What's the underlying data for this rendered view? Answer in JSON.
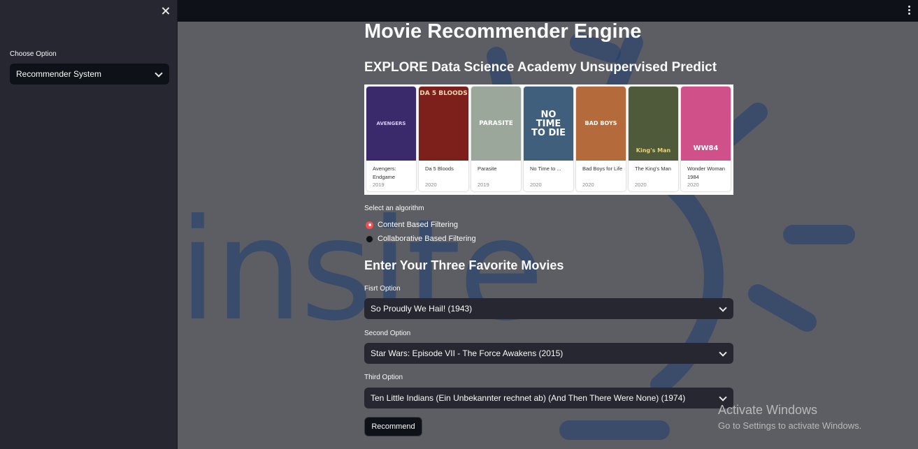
{
  "sidebar": {
    "label": "Choose Option",
    "selected": "Recommender System"
  },
  "main": {
    "title": "Movie Recommender Engine",
    "subtitle": "EXPLORE Data Science Academy Unsupervised Predict",
    "posters": [
      {
        "title": "Avengers: Endgame",
        "year": "2019",
        "art": "AVENGERS",
        "bg": "#3b2a6b",
        "fg": "#d9c9ff"
      },
      {
        "title": "Da 5 Bloods",
        "year": "2020",
        "art": "DA 5 BLOODS",
        "bg": "#7d1f1b",
        "fg": "#f2d7b0"
      },
      {
        "title": "Parasite",
        "year": "2019",
        "art": "PARASITE",
        "bg": "#9aa79a",
        "fg": "#ffffff"
      },
      {
        "title": "No Time to ...",
        "year": "2020",
        "art": "NO TIME TO DIE",
        "bg": "#3f5f7c",
        "fg": "#ffffff"
      },
      {
        "title": "Bad Boys for Life",
        "year": "2020",
        "art": "BAD BOYS",
        "bg": "#b46a3a",
        "fg": "#ffffff"
      },
      {
        "title": "The King's Man",
        "year": "2020",
        "art": "King's Man",
        "bg": "#4f5a3a",
        "fg": "#f0d070"
      },
      {
        "title": "Wonder Woman 1984",
        "year": "2020",
        "art": "WW84",
        "bg": "#d0508a",
        "fg": "#ffffff"
      }
    ],
    "algorithm_label": "Select an algorithm",
    "algorithms": [
      {
        "label": "Content Based Filtering",
        "selected": true
      },
      {
        "label": "Collaborative Based Filtering",
        "selected": false
      }
    ],
    "favorites_heading": "Enter Your Three Favorite Movies",
    "options": [
      {
        "label": "Fisrt Option",
        "value": "So Proudly We Hail! (1943)"
      },
      {
        "label": "Second Option",
        "value": "Star Wars: Episode VII - The Force Awakens (2015)"
      },
      {
        "label": "Third Option",
        "value": "Ten Little Indians (Ein Unbekannter rechnet ab) (And Then There Were None) (1974)"
      }
    ],
    "button_label": "Recommend"
  },
  "watermark": {
    "logo_text": "insite",
    "color": "#1f3e72"
  },
  "windows": {
    "activate_title": "Activate Windows",
    "activate_sub": "Go to Settings to activate Windows."
  },
  "colors": {
    "accent": "#ff4b4b",
    "sidebar_bg": "#262730",
    "main_bg": "#5d5e63",
    "header_bg": "#0e1117"
  }
}
